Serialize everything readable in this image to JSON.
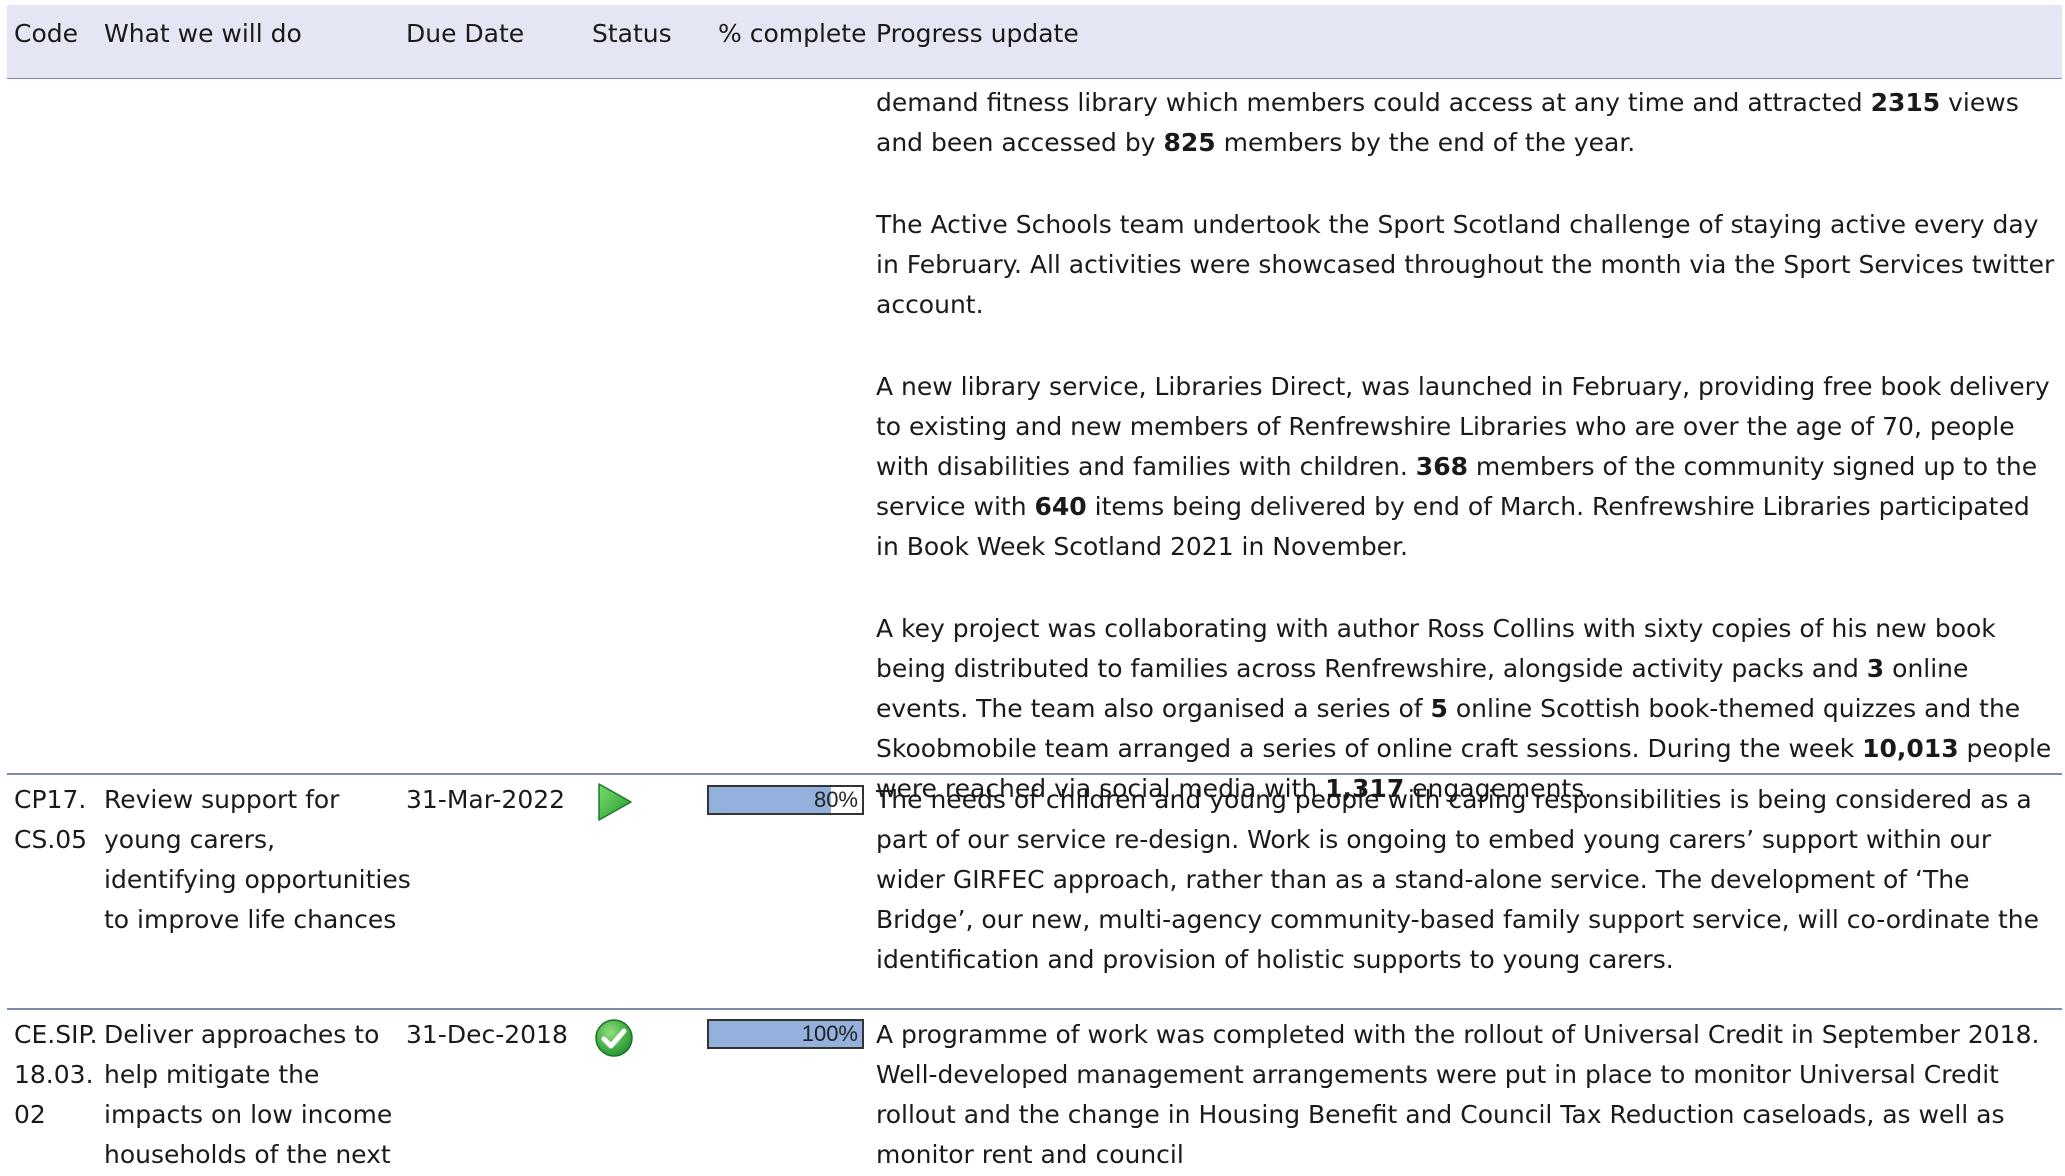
{
  "header": {
    "code": "Code",
    "what": "What we will do",
    "due": "Due Date",
    "status": "Status",
    "pct": "% complete",
    "progress": "Progress update"
  },
  "continuation": {
    "p1": [
      "demand fitness library which members could access at any time and attracted ",
      "2315",
      " views and been accessed by ",
      "825",
      " members by the end of the year."
    ],
    "p2": "The Active Schools team undertook the Sport Scotland challenge of staying active every day in February. All activities were showcased throughout the month via the Sport Services twitter account.",
    "p3": [
      "A new library service, Libraries Direct, was launched in February, providing free book delivery to existing and new members of Renfrewshire Libraries who are over the age of 70, people with disabilities and families with children. ",
      "368",
      " members of the community signed up to the service with ",
      "640",
      " items being delivered by end of March. Renfrewshire Libraries participated in Book Week Scotland 2021 in November."
    ],
    "p4": [
      "A key project was collaborating with author Ross Collins with sixty copies of his new book being distributed to families across Renfrewshire, alongside activity packs and ",
      "3",
      " online events. The team also organised a series of ",
      "5",
      " online Scottish book-themed quizzes and the Skoobmobile team arranged a series of online craft sessions. During the week ",
      "10,013",
      " people were reached via social media with ",
      "1,317",
      " engagements."
    ]
  },
  "rows": [
    {
      "code_lines": [
        "CP17.",
        "CS.05"
      ],
      "what_lines": [
        "Review support for",
        "young carers,",
        "identifying opportunities",
        "to improve life chances"
      ],
      "due": "31-Mar-2022",
      "status_icon": "play-arrow-icon",
      "status_color": "#3bb54a",
      "pct_label": "80%",
      "pct_value": 0.8,
      "progress": "The needs of children and young people with caring responsibilities is being considered as a part of our service re-design. Work is ongoing to embed young carers’ support within our wider GIRFEC approach, rather than as a stand-alone service. The development of ‘The Bridge’, our new, multi-agency community-based family support service, will co-ordinate the identification and provision of holistic supports to young carers."
    },
    {
      "code_lines": [
        "CE.SIP.",
        "18.03.",
        "02"
      ],
      "what_lines": [
        "Deliver approaches to",
        "help mitigate the",
        "impacts on low income",
        "households of the next"
      ],
      "due": "31-Dec-2018",
      "status_icon": "check-circle-icon",
      "status_color": "#3aa835",
      "pct_label": "100%",
      "pct_value": 1.0,
      "progress": "A programme of work was completed with the rollout of Universal Credit in September 2018. Well-developed management arrangements were put in place to monitor Universal Credit rollout and the change in Housing Benefit and Council Tax Reduction caseloads, as well as monitor rent and council"
    }
  ],
  "colors": {
    "header_bg": "#e4e7f3",
    "bar_fill": "#93b1dc",
    "rule": "#7f8aa8"
  }
}
